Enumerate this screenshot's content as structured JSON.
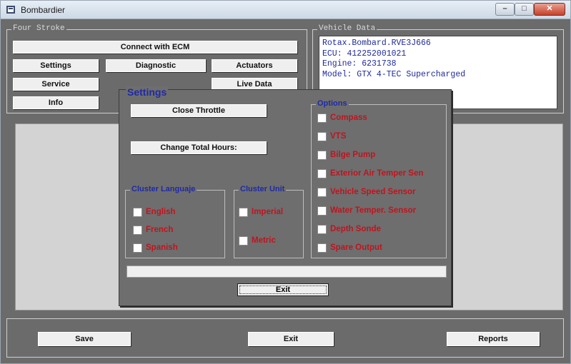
{
  "window": {
    "title": "Bombardier",
    "controls": {
      "minimize": "–",
      "maximize": "□",
      "close": "✕"
    }
  },
  "four_stroke": {
    "legend": "Four Stroke",
    "connect_label": "Connect with ECM",
    "buttons": {
      "settings": "Settings",
      "diagnostic": "Diagnostic",
      "actuators": "Actuators",
      "service": "Service",
      "live_data": "Live Data",
      "info": "Info"
    }
  },
  "vehicle_data": {
    "legend": "Vehicle Data",
    "lines": [
      "Rotax.Bombard.RVE3J666",
      "ECU: 412252001021",
      "Engine: 6231738",
      "Model: GTX 4-TEC Supercharged"
    ]
  },
  "settings_dialog": {
    "title": "Settings",
    "close_throttle": "Close Throttle",
    "change_total_hours": "Change Total Hours:",
    "cluster_language": {
      "legend": "Cluster Languaje",
      "options": [
        "English",
        "French",
        "Spanish"
      ]
    },
    "cluster_unit": {
      "legend": "Cluster Unit",
      "options": [
        "Imperial",
        "Metric"
      ]
    },
    "options": {
      "legend": "Options",
      "items": [
        "Compass",
        "VTS",
        "Bilge Pump",
        "Exterior Air Temper Sen",
        "Vehicle Speed Sensor",
        "Water Temper. Sensor",
        "Depth Sonde",
        "Spare Output"
      ]
    },
    "exit_label": "Exit"
  },
  "bottom": {
    "save": "Save",
    "exit": "Exit",
    "reports": "Reports"
  },
  "colors": {
    "panel_gray": "#6b6b6b",
    "label_red": "#c0141e",
    "legend_blue": "#1f2aa6",
    "vehicle_text_blue": "#1e2a9c"
  }
}
